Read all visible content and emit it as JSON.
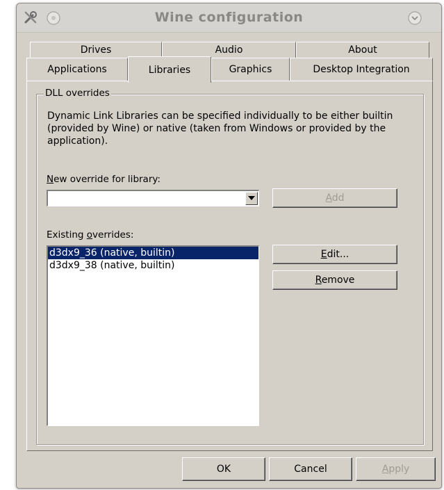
{
  "window": {
    "title": "Wine configuration"
  },
  "tabs": {
    "back_row": [
      "Drives",
      "Audio",
      "About"
    ],
    "front_row": [
      "Applications",
      "Libraries",
      "Graphics",
      "Desktop Integration"
    ],
    "active": "Libraries"
  },
  "dll_overrides": {
    "group_title": "DLL overrides",
    "description": "Dynamic Link Libraries can be specified individually to be either builtin (provided by Wine) or native (taken from Windows or provided by the application).",
    "new_override_label_underlined": "N",
    "new_override_label_rest": "ew override for library:",
    "new_override_value": "",
    "add_button_u": "A",
    "add_button_rest": "dd",
    "existing_label_pre": "Existing ",
    "existing_label_u": "o",
    "existing_label_rest": "verrides:",
    "overrides": [
      {
        "text": "d3dx9_36 (native, builtin)",
        "selected": true
      },
      {
        "text": "d3dx9_38 (native, builtin)",
        "selected": false
      }
    ],
    "edit_button_u": "E",
    "edit_button_rest": "dit...",
    "remove_button_u": "R",
    "remove_button_rest": "emove"
  },
  "footer": {
    "ok": "OK",
    "cancel": "Cancel",
    "apply_u": "A",
    "apply_rest": "pply"
  },
  "icons": [
    "tools-icon",
    "circle-icon",
    "chevron-down-icon",
    "dropdown-arrow-icon"
  ]
}
